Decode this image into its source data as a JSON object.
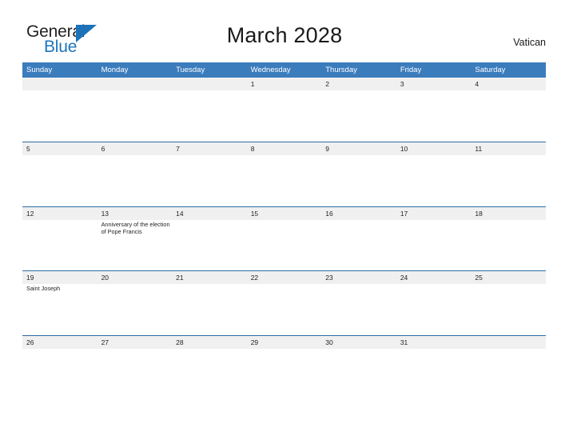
{
  "brand": {
    "name_part1": "General",
    "name_part2": "Blue",
    "triangle_color": "#1c72b8",
    "blue_color": "#1c75bc",
    "dark_color": "#231f20"
  },
  "header": {
    "title": "March 2028",
    "region": "Vatican"
  },
  "calendar": {
    "header_bg": "#3b7cbd",
    "header_text_color": "#ffffff",
    "row_separator_color": "#2e6da4",
    "date_band_color": "#f0f0f0",
    "day_names": [
      "Sunday",
      "Monday",
      "Tuesday",
      "Wednesday",
      "Thursday",
      "Friday",
      "Saturday"
    ],
    "weeks": [
      [
        {
          "day": "",
          "event": ""
        },
        {
          "day": "",
          "event": ""
        },
        {
          "day": "",
          "event": ""
        },
        {
          "day": "1",
          "event": ""
        },
        {
          "day": "2",
          "event": ""
        },
        {
          "day": "3",
          "event": ""
        },
        {
          "day": "4",
          "event": ""
        }
      ],
      [
        {
          "day": "5",
          "event": ""
        },
        {
          "day": "6",
          "event": ""
        },
        {
          "day": "7",
          "event": ""
        },
        {
          "day": "8",
          "event": ""
        },
        {
          "day": "9",
          "event": ""
        },
        {
          "day": "10",
          "event": ""
        },
        {
          "day": "11",
          "event": ""
        }
      ],
      [
        {
          "day": "12",
          "event": ""
        },
        {
          "day": "13",
          "event": "Anniversary of the election of Pope Francis"
        },
        {
          "day": "14",
          "event": ""
        },
        {
          "day": "15",
          "event": ""
        },
        {
          "day": "16",
          "event": ""
        },
        {
          "day": "17",
          "event": ""
        },
        {
          "day": "18",
          "event": ""
        }
      ],
      [
        {
          "day": "19",
          "event": "Saint Joseph"
        },
        {
          "day": "20",
          "event": ""
        },
        {
          "day": "21",
          "event": ""
        },
        {
          "day": "22",
          "event": ""
        },
        {
          "day": "23",
          "event": ""
        },
        {
          "day": "24",
          "event": ""
        },
        {
          "day": "25",
          "event": ""
        }
      ],
      [
        {
          "day": "26",
          "event": ""
        },
        {
          "day": "27",
          "event": ""
        },
        {
          "day": "28",
          "event": ""
        },
        {
          "day": "29",
          "event": ""
        },
        {
          "day": "30",
          "event": ""
        },
        {
          "day": "31",
          "event": ""
        },
        {
          "day": "",
          "event": ""
        }
      ]
    ]
  }
}
